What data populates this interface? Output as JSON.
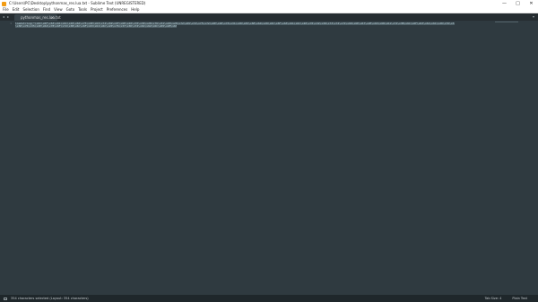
{
  "window": {
    "title": "C:\\Users\\PC\\Desktop\\pythonmas_res.lua.txt - Sublime Text (UNREGISTERED)",
    "minimize": "—",
    "maximize": "□",
    "close": "✕"
  },
  "menu": [
    "File",
    "Edit",
    "Selection",
    "Find",
    "View",
    "Goto",
    "Tools",
    "Project",
    "Preferences",
    "Help"
  ],
  "tabs": [
    {
      "label": "pythonmas_res.lua.txt",
      "close": "×"
    }
  ],
  "tabbar": {
    "nav": "◂ ▸",
    "dropdown": "▾"
  },
  "editor": {
    "line_numbers": [
      "1"
    ],
    "lines": [
      "loadstring(\"\\x6C\\x6F\\x63\\x61\\x6C\\x20\\x66\\x75\\x6E\\x63\\x74\\x69\\x6F\\x6E\\x20\\x76\\x30\\x28\\x76\\x31\\x29\\x20\\x72\\x65\\x74\\x75\\x72\\x6E\\x20\\x76\\x31\\x20\\x65\\x6E\\x64\\x20\\x6C\\x6F\\x63\\x61\\x6C\\x20\\x76\\x32\\x3D\\x73\\x74\\x72\\x69\\x6E\\x67\\x2E\\x63\\x68\\x61\\x72\\x3B\\x6C\\x6F\\x63\\x61\\x6C\\x20\\x76\\x33\\x3D\\x73\\x74\\x72\\x69\\x6E\\x67\\x2E\\x62\\x79\\x74\\x65\\x3B\\x6C\\x6F\\x63\\x61\\x6C\\x20\\x76\\x34\\x3D\\x73\\x74\\x72\\x69\\x6E\\x67\\x2E\\x73\\x75\\x62\\x3B\\x6C\\x6F\\x63\\x61\\x6C\\x20\\x76\\x35\\x3D\\x62\\x69\\x74\\x33\\x32\\x20\\x6F\\x72\\x20\\x62\\x69\\x74\\x3B\\x6C\\x6F\\x63\\x61\\x6C\\x20\\x76\\x36",
      "\\x3D\\x76\\x35\\x2E\\x62\\x78\\x6F\\x72\\x3B\\x6C\\x6F\\x63\\x61\\x6C\\x20\\x76\\x37\\x3D\\x74\\x61\\x62\\x6C\\x65\\x2E\\x63\\x6F\\x6E\\x63\\x61\\x74\\x3B\\x6C\\x6F\\x63\\x61\\x6C\\x20\\x76\\x38\\x3D\\x74\\x61\\x62\\x6C\\x65\\x2E\\x69\\x6E\\x73\\x65\\x72\\x74\\x3B\\x65\\x6E\\x64\")()_loadstr(1)"
    ]
  },
  "status": {
    "selection": "354 characters selected (Layout: 354 characters)",
    "tab_size": "Tab Size: 4",
    "syntax": "Plain Text"
  }
}
